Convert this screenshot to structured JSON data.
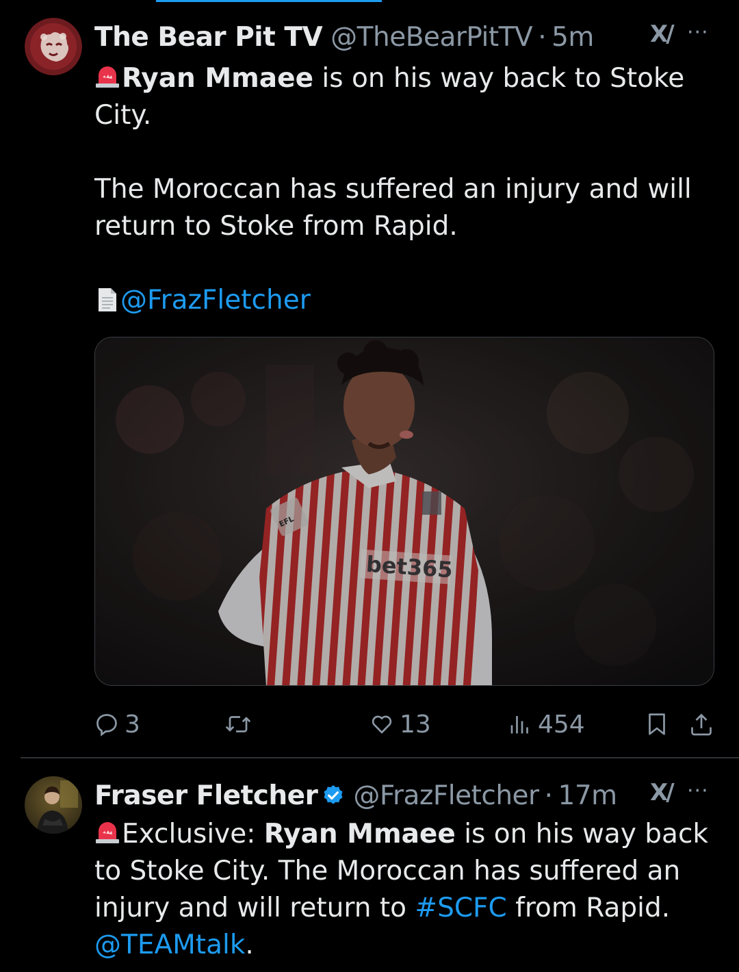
{
  "tweet1": {
    "display_name": "The Bear Pit TV",
    "handle": "@TheBearPitTV",
    "separator": "·",
    "time": "5m",
    "body": {
      "line1_bold": "Ryan Mmaee",
      "line1_rest": " is on his way back to Stoke City.",
      "para2": "The Moroccan has suffered an injury and will return to Stoke from Rapid.",
      "mention": "@FrazFletcher"
    },
    "media": {
      "sponsor": "bet365",
      "sleeve_badge": "EFL"
    },
    "actions": {
      "replies": "3",
      "reposts": "",
      "likes": "13",
      "views": "454"
    }
  },
  "tweet2": {
    "display_name": "Fraser Fletcher",
    "verified": true,
    "handle": "@FrazFletcher",
    "separator": "·",
    "time": "17m",
    "body": {
      "prefix": "Exclusive: ",
      "bold": "Ryan Mmaee",
      "rest1": " is on his way back to Stoke City. The Moroccan has suffered an injury and will return to ",
      "hashtag": "#SCFC",
      "rest2": " from Rapid. ",
      "mention": "@TEAMtalk",
      "end": "."
    }
  },
  "icons": {
    "grok": "grok-icon",
    "more": "more-icon"
  },
  "labels": {
    "grok": "X/",
    "more": "···"
  },
  "colors": {
    "background": "#000000",
    "text": "#e7e9ea",
    "muted": "#8b98a5",
    "link": "#1d9bf0",
    "divider": "#2f3336",
    "avatar_bear": "#7a1a1e",
    "verified": "#1d9bf0"
  }
}
